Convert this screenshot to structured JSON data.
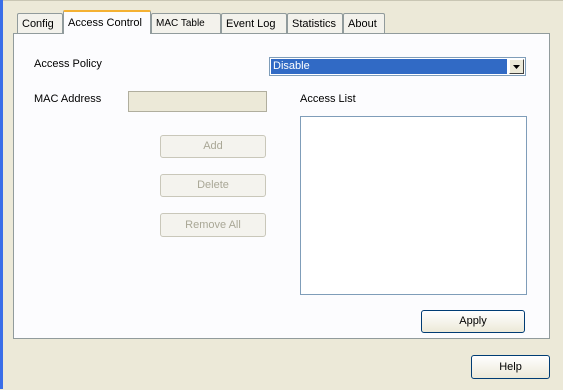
{
  "tabs": [
    {
      "label": "Config"
    },
    {
      "label": "Access Control"
    },
    {
      "label": "MAC Table"
    },
    {
      "label": "Event Log"
    },
    {
      "label": "Statistics"
    },
    {
      "label": "About"
    }
  ],
  "access_control": {
    "policy_label": "Access Policy",
    "policy_value": "Disable",
    "mac_label": "MAC Address",
    "mac_value": "",
    "list_label": "Access List",
    "add_label": "Add",
    "delete_label": "Delete",
    "remove_all_label": "Remove All",
    "apply_label": "Apply"
  },
  "footer": {
    "help_label": "Help"
  },
  "colors": {
    "selection": "#316ac5",
    "active_tab_accent": "#f4b133",
    "window_background": "#ece9d8"
  }
}
